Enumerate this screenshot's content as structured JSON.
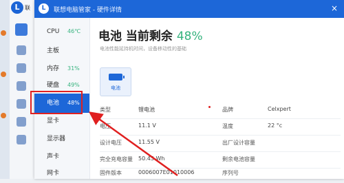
{
  "background_app": {
    "tag": "联"
  },
  "dialog": {
    "title": "联想电脑管家 - 硬件详情",
    "logo": "L",
    "close": "×"
  },
  "sidebar": {
    "items": [
      {
        "label": "CPU",
        "value": "46℃"
      },
      {
        "label": "主板",
        "value": ""
      },
      {
        "label": "内存",
        "value": "31%"
      },
      {
        "label": "硬盘",
        "value": "49%"
      },
      {
        "label": "电池",
        "value": "48%"
      },
      {
        "label": "显卡",
        "value": ""
      },
      {
        "label": "显示器",
        "value": ""
      },
      {
        "label": "声卡",
        "value": ""
      },
      {
        "label": "网卡",
        "value": ""
      }
    ],
    "active_index": 4
  },
  "main": {
    "title": "电池 当前剩余",
    "percent": "48%",
    "subtitle": "电池性能延持机时间，设备移动性的基础",
    "device_tile": "电池"
  },
  "details": {
    "rows": [
      {
        "k1": "类型",
        "v1": "锂电池",
        "k2": "品牌",
        "v2": "Celxpert"
      },
      {
        "k1": "电压",
        "v1": "11.1 V",
        "k2": "温度",
        "v2": "22 °c"
      },
      {
        "k1": "设计电压",
        "v1": "11.55 V",
        "k2": "出厂设计容量",
        "v2": ""
      },
      {
        "k1": "完全充电容量",
        "v1": "50.43 Wh",
        "k2": "剩余电池容量",
        "v2": ""
      },
      {
        "k1": "固件版本",
        "v1": "0006007E01010006",
        "k2": "序列号",
        "v2": ""
      }
    ]
  },
  "colors": {
    "brand": "#1d67d8",
    "accent_green": "#36b37e",
    "annotation_red": "#e02020"
  }
}
